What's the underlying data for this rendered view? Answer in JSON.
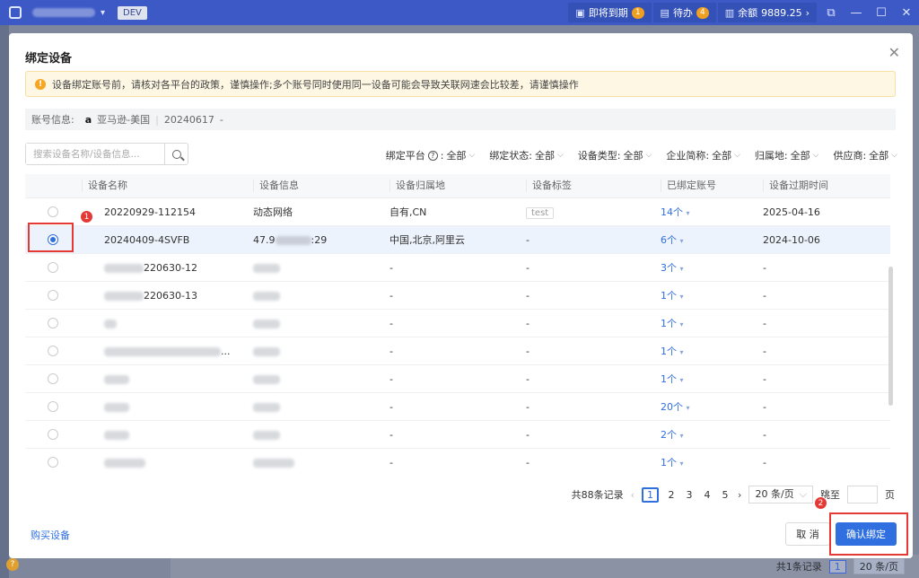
{
  "titlebar": {
    "env": "DEV",
    "expiring_label": "即将到期",
    "expiring_count": "1",
    "todo_label": "待办",
    "todo_count": "4",
    "balance_label": "余额",
    "balance_value": "9889.25"
  },
  "dialog": {
    "title": "绑定设备",
    "notice": "设备绑定账号前，请核对各平台的政策，谨慎操作;多个账号同时使用同一设备可能会导致关联网速会比较差，请谨慎操作",
    "account_label": "账号信息:",
    "account_platform_icon": "a",
    "account_name": "亚马逊-美国",
    "account_id": "20240617",
    "account_suffix": "-",
    "search_placeholder": "搜索设备名称/设备信息...",
    "filters": [
      {
        "label": "绑定平台",
        "value": "全部",
        "help": true
      },
      {
        "label": "绑定状态:",
        "value": "全部"
      },
      {
        "label": "设备类型:",
        "value": "全部"
      },
      {
        "label": "企业简称:",
        "value": "全部"
      },
      {
        "label": "归属地:",
        "value": "全部"
      },
      {
        "label": "供应商:",
        "value": "全部"
      }
    ],
    "filter_colon": ":",
    "help_glyph": "?",
    "columns": [
      "设备名称",
      "设备信息",
      "设备归属地",
      "设备标签",
      "已绑定账号",
      "设备过期时间"
    ],
    "rows": [
      {
        "name": "20220929-112154",
        "info": "动态网络",
        "location": "自有,CN",
        "tag": "test",
        "bound": "14个",
        "expire": "2025-04-16"
      },
      {
        "name": "20240409-4SVFB",
        "info_prefix": "47.9",
        "info_suffix": ":29",
        "location": "中国,北京,阿里云",
        "tag": "-",
        "bound": "6个",
        "expire": "2024-10-06"
      },
      {
        "name_suffix": "220630-12",
        "location": "-",
        "tag": "-",
        "bound": "3个",
        "expire": "-"
      },
      {
        "name_suffix": "220630-13",
        "location": "-",
        "tag": "-",
        "bound": "1个",
        "expire": "-"
      },
      {
        "location": "-",
        "tag": "-",
        "bound": "1个",
        "expire": "-"
      },
      {
        "name_suffix": "...",
        "location": "-",
        "tag": "-",
        "bound": "1个",
        "expire": "-"
      },
      {
        "location": "-",
        "tag": "-",
        "bound": "1个",
        "expire": "-"
      },
      {
        "location": "-",
        "tag": "-",
        "bound": "20个",
        "expire": "-"
      },
      {
        "location": "-",
        "tag": "-",
        "bound": "2个",
        "expire": "-"
      },
      {
        "location": "-",
        "tag": "-",
        "bound": "1个",
        "expire": "-"
      }
    ],
    "pagination": {
      "total": "共88条记录",
      "pages": [
        "1",
        "2",
        "3",
        "4",
        "5"
      ],
      "page_size": "20 条/页",
      "jump_label": "跳至",
      "page_unit": "页"
    },
    "buy_link": "购买设备",
    "cancel": "取 消",
    "confirm": "确认绑定",
    "markers": [
      "1",
      "2"
    ]
  },
  "background": {
    "total": "共1条记录",
    "page": "1",
    "page_size": "20 条/页"
  },
  "colors": {
    "accent": "#2f6fe0",
    "highlight": "#e53935",
    "titlebar": "#3c59c6"
  }
}
